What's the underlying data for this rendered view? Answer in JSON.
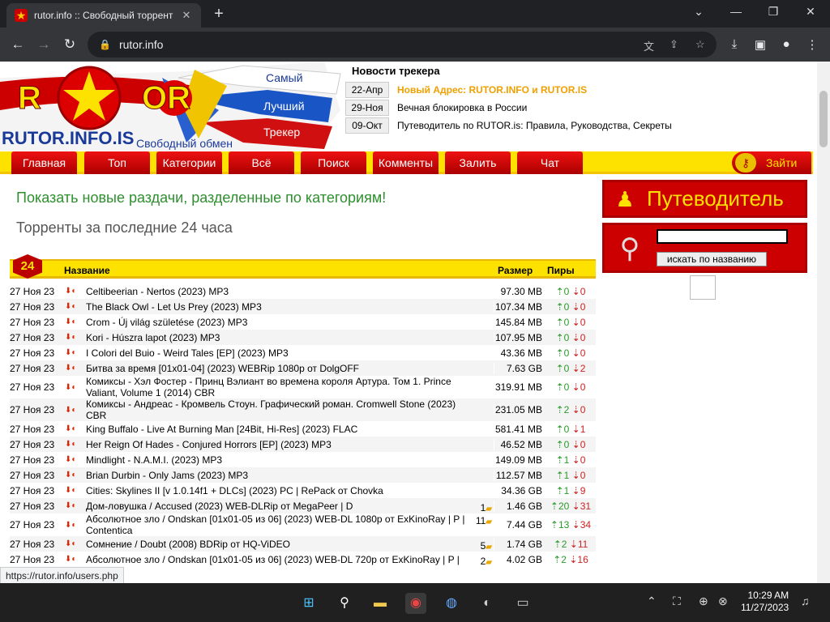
{
  "browser": {
    "tab_title": "rutor.info :: Свободный торрент",
    "url": "rutor.info",
    "status_link": "https://rutor.info/users.php"
  },
  "news": {
    "heading": "Новости трекера",
    "items": [
      {
        "date": "22-Апр",
        "text": "Новый Адрес: RUTOR.INFO и RUTOR.IS"
      },
      {
        "date": "29-Ноя",
        "text": "Вечная блокировка в России"
      },
      {
        "date": "09-Окт",
        "text": "Путеводитель по RUTOR.is: Правила, Руководства, Секреты"
      }
    ]
  },
  "logo": {
    "site": "RUTOR",
    "domain": "RUTOR.INFO.IS",
    "slogan1": "Самый",
    "slogan2": "Лучший",
    "slogan3": "Трекер",
    "tagline": "Свободный обмен"
  },
  "menu": {
    "items": [
      "Главная",
      "Топ",
      "Категории",
      "Всё",
      "Поиск",
      "Комменты",
      "Залить",
      "Чат"
    ],
    "login": "Зайти"
  },
  "main": {
    "link_new": "Показать новые раздачи, разделенные по категориям!",
    "heading_24h": "Торренты за последние 24 часа",
    "badge": "24",
    "col_name": "Название",
    "col_size": "Размер",
    "col_peers": "Пиры"
  },
  "torrents": [
    {
      "date": "27 Ноя 23",
      "name": "Celtibeerian - Nertos (2023) MP3",
      "comments": "",
      "size": "97.30 MB",
      "seeds": "0",
      "leech": "0"
    },
    {
      "date": "27 Ноя 23",
      "name": "The Black Owl - Let Us Prey (2023) MP3",
      "comments": "",
      "size": "107.34 MB",
      "seeds": "0",
      "leech": "0"
    },
    {
      "date": "27 Ноя 23",
      "name": "Crom - Új világ születése (2023) MP3",
      "comments": "",
      "size": "145.84 MB",
      "seeds": "0",
      "leech": "0"
    },
    {
      "date": "27 Ноя 23",
      "name": "Kori - Húszra lapot (2023) MP3",
      "comments": "",
      "size": "107.95 MB",
      "seeds": "0",
      "leech": "0"
    },
    {
      "date": "27 Ноя 23",
      "name": "I Colori del Buio - Weird Tales [EP] (2023) MP3",
      "comments": "",
      "size": "43.36 MB",
      "seeds": "0",
      "leech": "0"
    },
    {
      "date": "27 Ноя 23",
      "name": "Битва за время [01x01-04] (2023) WEBRip 1080p от DolgOFF",
      "comments": "",
      "size": "7.63 GB",
      "seeds": "0",
      "leech": "2"
    },
    {
      "date": "27 Ноя 23",
      "name": "Комиксы - Хэл Фостер - Принц Вэлиант во времена короля Артура. Том 1. Prince Valiant, Volume 1 (2014) CBR",
      "comments": "",
      "size": "319.91 MB",
      "seeds": "0",
      "leech": "0"
    },
    {
      "date": "27 Ноя 23",
      "name": "Комиксы - Андреас - Кромвель Стоун. Графический роман. Cromwell Stone (2023) CBR",
      "comments": "",
      "size": "231.05 MB",
      "seeds": "2",
      "leech": "0"
    },
    {
      "date": "27 Ноя 23",
      "name": "King Buffalo - Live At Burning Man [24Bit, Hi-Res] (2023) FLAC",
      "comments": "",
      "size": "581.41 MB",
      "seeds": "0",
      "leech": "1"
    },
    {
      "date": "27 Ноя 23",
      "name": "Her Reign Of Hades - Conjured Horrors [EP] (2023) MP3",
      "comments": "",
      "size": "46.52 MB",
      "seeds": "0",
      "leech": "0"
    },
    {
      "date": "27 Ноя 23",
      "name": "Mindlight - N.A.M.I. (2023) MP3",
      "comments": "",
      "size": "149.09 MB",
      "seeds": "1",
      "leech": "0"
    },
    {
      "date": "27 Ноя 23",
      "name": "Brian Durbin - Only Jams (2023) MP3",
      "comments": "",
      "size": "112.57 MB",
      "seeds": "1",
      "leech": "0"
    },
    {
      "date": "27 Ноя 23",
      "name": "Cities: Skylines II [v 1.0.14f1 + DLCs] (2023) PC | RePack от Chovka",
      "comments": "",
      "size": "34.36 GB",
      "seeds": "1",
      "leech": "9"
    },
    {
      "date": "27 Ноя 23",
      "name": "Дом-ловушка / Accused (2023) WEB-DLRip от MegaPeer | D",
      "comments": "1",
      "size": "1.46 GB",
      "seeds": "20",
      "leech": "31"
    },
    {
      "date": "27 Ноя 23",
      "name": "Абсолютное зло / Ondskan [01x01-05 из 06] (2023) WEB-DL 1080p от ExKinoRay | P | Contentica",
      "comments": "11",
      "size": "7.44 GB",
      "seeds": "13",
      "leech": "34"
    },
    {
      "date": "27 Ноя 23",
      "name": "Сомнение / Doubt (2008) BDRip от HQ-ViDEO",
      "comments": "5",
      "size": "1.74 GB",
      "seeds": "2",
      "leech": "11"
    },
    {
      "date": "27 Ноя 23",
      "name": "Абсолютное зло / Ondskan [01x01-05 из 06] (2023) WEB-DL 720p от ExKinoRay | P |",
      "comments": "2",
      "size": "4.02 GB",
      "seeds": "2",
      "leech": "16"
    }
  ],
  "sidebar": {
    "guide": "Путеводитель",
    "search_button": "искать по названию",
    "search_value": ""
  },
  "taskbar": {
    "time": "10:29 AM",
    "date": "11/27/2023"
  },
  "colors": {
    "menu_yellow": "#fde200",
    "menu_red": "#c00000",
    "link_green": "#2f8f2f",
    "news_highlight": "#f0a000"
  }
}
